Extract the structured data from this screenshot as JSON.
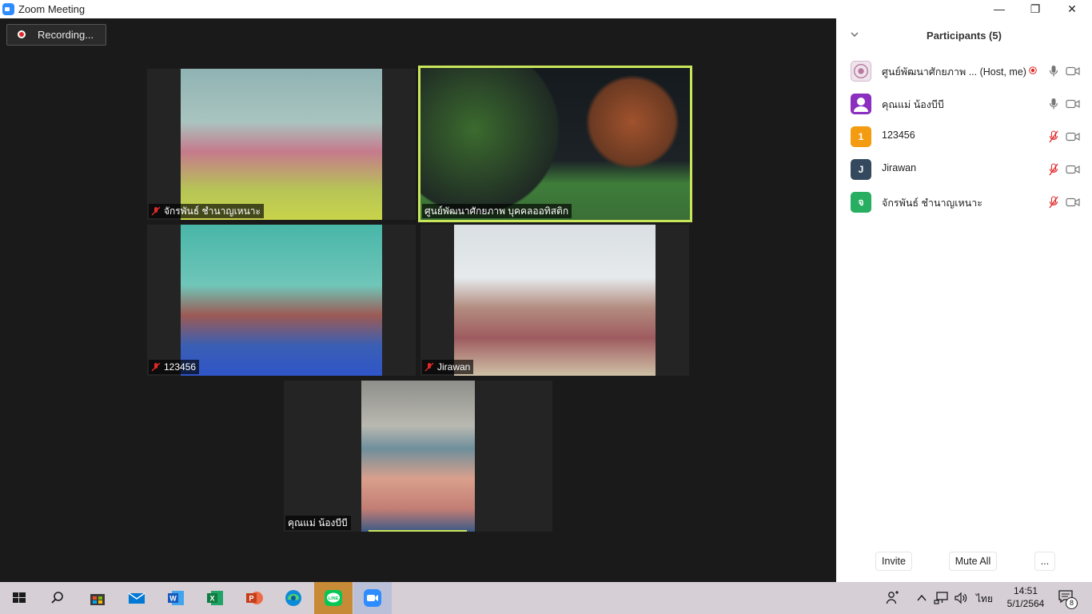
{
  "window": {
    "title": "Zoom Meeting",
    "minimize": "—",
    "restore": "❐",
    "close": "✕"
  },
  "recording": {
    "label": "Recording..."
  },
  "tiles": [
    {
      "name": "จักรพันธ์ ชำนาญเหนาะ",
      "muted": true
    },
    {
      "name": "ศูนย์พัฒนาศักยภาพ บุคคลออทิสติก",
      "muted": false,
      "active": true
    },
    {
      "name": "123456",
      "muted": true
    },
    {
      "name": "Jirawan",
      "muted": true
    },
    {
      "name": "คุณแม่ น้องบีบี",
      "muted": false
    }
  ],
  "participants": {
    "title": "Participants (5)",
    "list": [
      {
        "name": "ศูนย์พัฒนาศักยภาพ ...",
        "tag": "(Host, me)",
        "avatar": "",
        "avatar_color": "#e8d8e4",
        "recording": true,
        "mic": "on",
        "cam": "off"
      },
      {
        "name": "คุณแม่ น้องบีบี",
        "tag": "",
        "avatar": "",
        "avatar_color": "#8a2fbf",
        "recording": false,
        "mic": "on",
        "cam": "off"
      },
      {
        "name": "123456",
        "tag": "",
        "avatar": "1",
        "avatar_color": "#f39c12",
        "recording": false,
        "mic": "muted",
        "cam": "off"
      },
      {
        "name": "Jirawan",
        "tag": "",
        "avatar": "J",
        "avatar_color": "#34495e",
        "recording": false,
        "mic": "muted",
        "cam": "off"
      },
      {
        "name": "จักรพันธ์ ชำนาญเหนาะ",
        "tag": "",
        "avatar": "จ",
        "avatar_color": "#27ae60",
        "recording": false,
        "mic": "muted",
        "cam": "off"
      }
    ],
    "buttons": {
      "invite": "Invite",
      "mute_all": "Mute All",
      "more": "..."
    }
  },
  "taskbar": {
    "apps": [
      "windows-start",
      "search",
      "microsoft-store",
      "mail",
      "word",
      "excel",
      "powerpoint",
      "edge",
      "line",
      "zoom"
    ],
    "lang": "ไทย",
    "time": "14:51",
    "date": "5/1/2564",
    "notifications": "8"
  },
  "colors": {
    "active_speaker": "#c9e65a",
    "muted_red": "#e02828",
    "zoom_blue": "#2d8cff"
  }
}
